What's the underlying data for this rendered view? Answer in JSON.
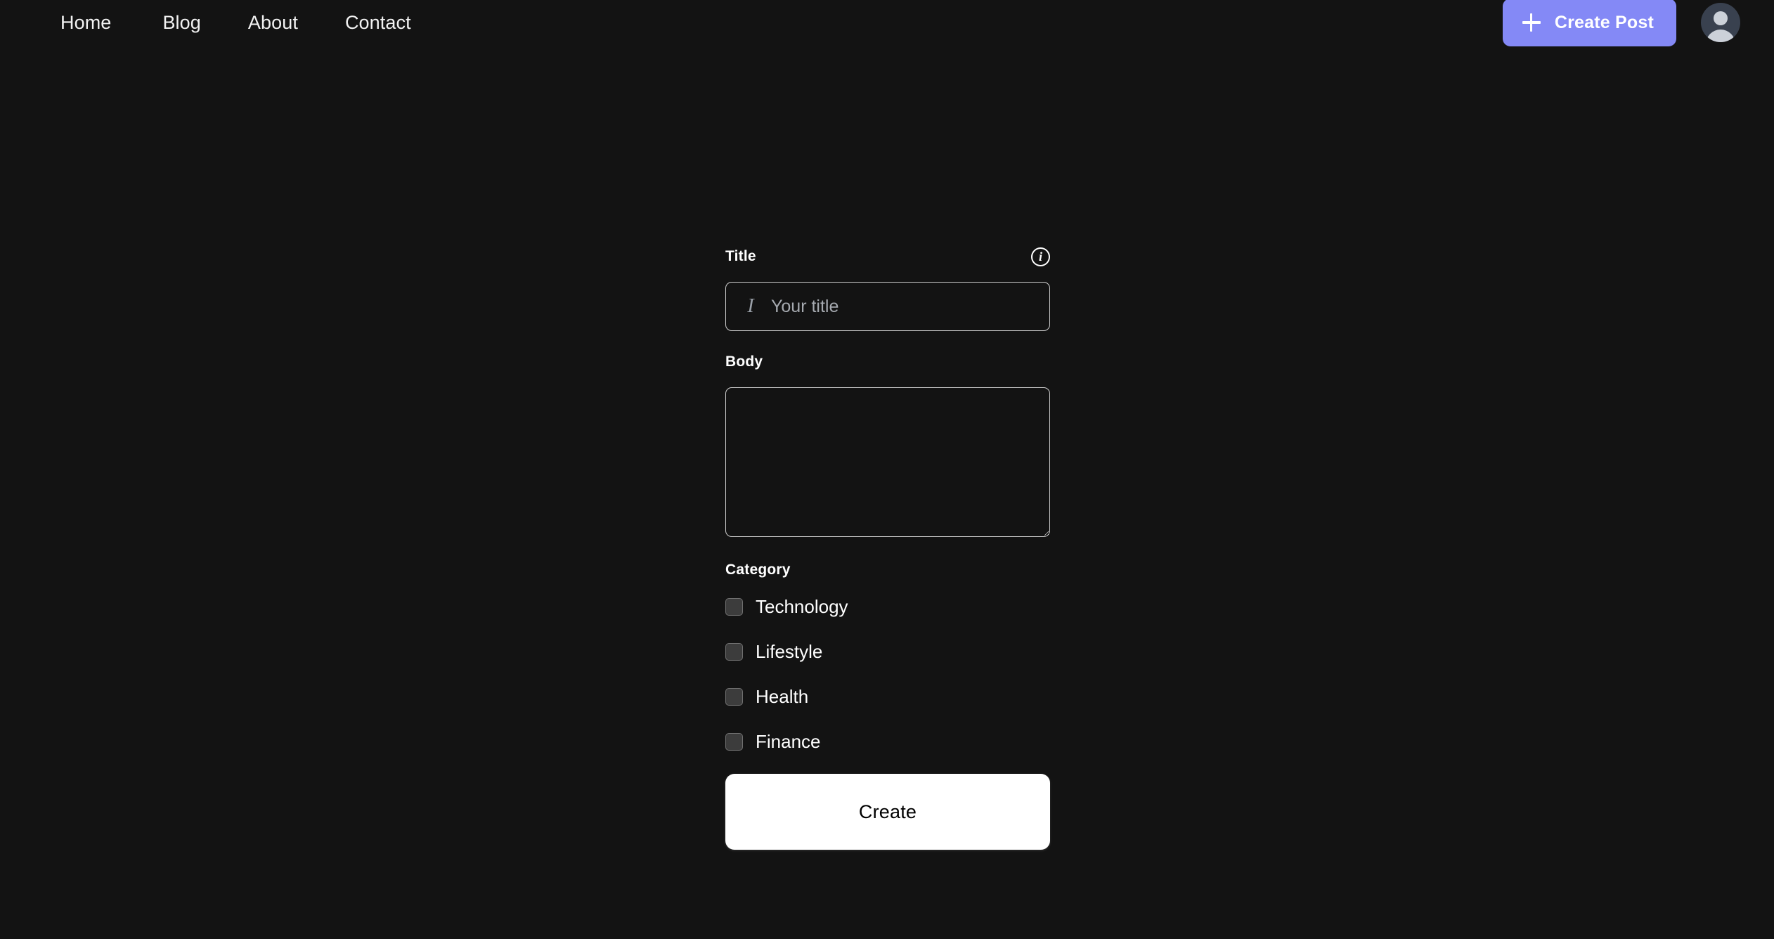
{
  "theme": {
    "background": "#131313",
    "accent": "#8489f6",
    "text": "#ffffff",
    "muted_text": "#a6aab0",
    "border": "#cfcfcf",
    "checkbox_fill": "#3c3c3c",
    "checkbox_border": "#707070",
    "avatar_bg": "#39414f",
    "avatar_fg": "#ccd1d9",
    "primary_button_bg": "#ffffff",
    "primary_button_text": "#000000"
  },
  "navbar": {
    "links": [
      {
        "label": "Home"
      },
      {
        "label": "Blog"
      },
      {
        "label": "About"
      },
      {
        "label": "Contact"
      }
    ],
    "create_post_button": {
      "label": "Create Post",
      "icon": "plus-icon"
    },
    "avatar": {
      "icon": "user-avatar-icon"
    }
  },
  "form": {
    "title_field": {
      "label": "Title",
      "info_icon": "info-icon",
      "input_icon": "italic-text-icon",
      "placeholder": "Your title",
      "value": ""
    },
    "body_field": {
      "label": "Body",
      "placeholder": "",
      "value": ""
    },
    "category_field": {
      "label": "Category",
      "options": [
        {
          "label": "Technology",
          "checked": false
        },
        {
          "label": "Lifestyle",
          "checked": false
        },
        {
          "label": "Health",
          "checked": false
        },
        {
          "label": "Finance",
          "checked": false
        }
      ]
    },
    "submit_button": {
      "label": "Create"
    }
  }
}
